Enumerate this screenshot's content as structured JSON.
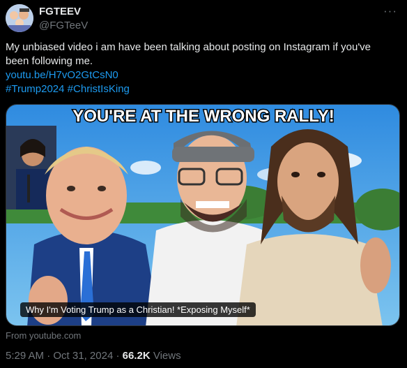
{
  "author": {
    "display_name": "FGTEEV",
    "handle": "@FGTeeV",
    "avatar_icon": "fgteev-avatar"
  },
  "more_icon": "···",
  "post": {
    "line1": "My unbiased video i am have been talking about posting on Instagram if you've",
    "line2": "been following me.",
    "link": "youtu.be/H7vO2GtCsN0",
    "hashtag1": "#Trump2024",
    "hashtag2": "#ChristIsKing"
  },
  "card": {
    "thumbnail_text": "YOU'RE AT THE WRONG RALLY!",
    "video_title": "Why I'm Voting Trump as a Christian! *Exposing Myself*",
    "source": "From youtube.com"
  },
  "meta": {
    "time": "5:29 AM",
    "date": "Oct 31, 2024",
    "separator": " · ",
    "views_count": "66.2K",
    "views_label": "Views"
  },
  "colors": {
    "background": "#000000",
    "link": "#1d9bf0",
    "secondary_text": "#71767b",
    "primary_text": "#e7e9ea"
  }
}
